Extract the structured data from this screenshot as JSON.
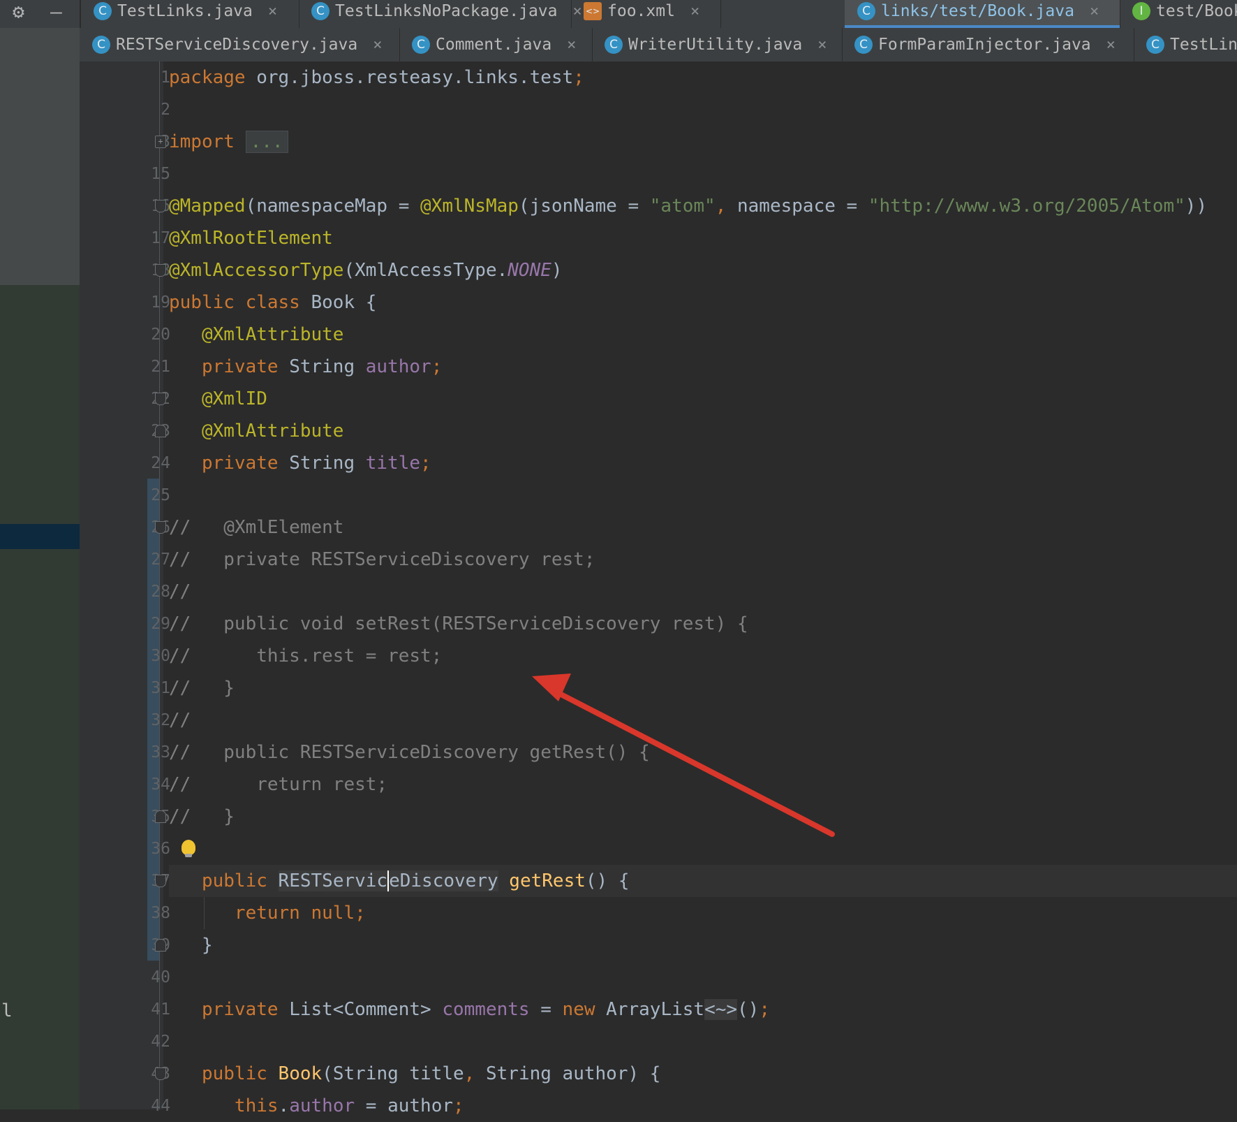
{
  "toolbar": {
    "settings_icon": "gear-icon",
    "hide_icon": "minimize-icon"
  },
  "tabs_row1": [
    {
      "label": "TestLinks.java",
      "icon": "C",
      "active": false
    },
    {
      "label": "TestLinksNoPackage.java",
      "icon": "C",
      "active": false
    },
    {
      "label": "foo.xml",
      "icon": "<>",
      "active": false
    },
    {
      "label": "links/test/Book.java",
      "icon": "C",
      "active": true
    },
    {
      "label": "test/BookStoreSer",
      "icon": "I",
      "active": false
    }
  ],
  "tabs_row2": [
    {
      "label": "RESTServiceDiscovery.java",
      "icon": "C"
    },
    {
      "label": "Comment.java",
      "icon": "C"
    },
    {
      "label": "WriterUtility.java",
      "icon": "C"
    },
    {
      "label": "FormParamInjector.java",
      "icon": "C"
    },
    {
      "label": "TestLin",
      "icon": "C"
    }
  ],
  "close_glyph": "×",
  "left_panel": {
    "stray_char": "l"
  },
  "editor": {
    "line_numbers": [
      "1",
      "2",
      "3",
      "15",
      "16",
      "17",
      "18",
      "19",
      "20",
      "21",
      "22",
      "23",
      "24",
      "25",
      "26",
      "27",
      "28",
      "29",
      "30",
      "31",
      "32",
      "33",
      "34",
      "35",
      "36",
      "37",
      "38",
      "39",
      "40",
      "41",
      "42",
      "43",
      "44"
    ],
    "lines": [
      [
        {
          "t": "package ",
          "c": "kw"
        },
        {
          "t": "org.jboss.resteasy.links.test",
          "c": ""
        },
        {
          "t": ";",
          "c": "kw"
        }
      ],
      [],
      [
        {
          "t": "import ",
          "c": "kw"
        },
        {
          "t": "...",
          "c": "fold-box"
        }
      ],
      [],
      [
        {
          "t": "@Mapped",
          "c": "ann"
        },
        {
          "t": "(namespaceMap = ",
          "c": ""
        },
        {
          "t": "@XmlNsMap",
          "c": "ann"
        },
        {
          "t": "(jsonName = ",
          "c": ""
        },
        {
          "t": "\"atom\"",
          "c": "str"
        },
        {
          "t": ", ",
          "c": "kw"
        },
        {
          "t": "namespace = ",
          "c": ""
        },
        {
          "t": "\"http://www.w3.org/2005/Atom\"",
          "c": "str"
        },
        {
          "t": "))",
          "c": ""
        }
      ],
      [
        {
          "t": "@XmlRootElement",
          "c": "ann"
        }
      ],
      [
        {
          "t": "@XmlAccessorType",
          "c": "ann"
        },
        {
          "t": "(XmlAccessType.",
          "c": ""
        },
        {
          "t": "NONE",
          "c": "fld-i"
        },
        {
          "t": ")",
          "c": ""
        }
      ],
      [
        {
          "t": "public class ",
          "c": "kw"
        },
        {
          "t": "Book {",
          "c": ""
        }
      ],
      [
        {
          "t": "   @XmlAttribute",
          "c": "ann"
        }
      ],
      [
        {
          "t": "   private ",
          "c": "kw"
        },
        {
          "t": "String ",
          "c": ""
        },
        {
          "t": "author",
          "c": "fld"
        },
        {
          "t": ";",
          "c": "kw"
        }
      ],
      [
        {
          "t": "   @XmlID",
          "c": "ann"
        }
      ],
      [
        {
          "t": "   @XmlAttribute",
          "c": "ann"
        }
      ],
      [
        {
          "t": "   private ",
          "c": "kw"
        },
        {
          "t": "String ",
          "c": ""
        },
        {
          "t": "title",
          "c": "fld"
        },
        {
          "t": ";",
          "c": "kw"
        }
      ],
      [],
      [
        {
          "t": "//   @XmlElement",
          "c": "cmt"
        }
      ],
      [
        {
          "t": "//   private RESTServiceDiscovery rest;",
          "c": "cmt"
        }
      ],
      [
        {
          "t": "//",
          "c": "cmt"
        }
      ],
      [
        {
          "t": "//   public void setRest(RESTServiceDiscovery rest) {",
          "c": "cmt"
        }
      ],
      [
        {
          "t": "//      this.rest = rest;",
          "c": "cmt"
        }
      ],
      [
        {
          "t": "//   }",
          "c": "cmt"
        }
      ],
      [
        {
          "t": "//",
          "c": "cmt"
        }
      ],
      [
        {
          "t": "//   public RESTServiceDiscovery getRest() {",
          "c": "cmt"
        }
      ],
      [
        {
          "t": "//      return rest;",
          "c": "cmt"
        }
      ],
      [
        {
          "t": "//   }",
          "c": "cmt"
        }
      ],
      [],
      [
        {
          "t": "   public ",
          "c": "kw"
        },
        {
          "t": "RESTServic",
          "c": "hl"
        },
        {
          "t": "eDiscovery",
          "c": "hl caret"
        },
        {
          "t": " ",
          "c": ""
        },
        {
          "t": "getRest",
          "c": "fn"
        },
        {
          "t": "() {",
          "c": ""
        }
      ],
      [
        {
          "t": "      return null",
          "c": "kw"
        },
        {
          "t": ";",
          "c": "kw"
        }
      ],
      [
        {
          "t": "   }",
          "c": ""
        }
      ],
      [],
      [
        {
          "t": "   private ",
          "c": "kw"
        },
        {
          "t": "List<Comment> ",
          "c": ""
        },
        {
          "t": "comments ",
          "c": "fld"
        },
        {
          "t": "= ",
          "c": ""
        },
        {
          "t": "new ",
          "c": "kw"
        },
        {
          "t": "ArrayList",
          "c": ""
        },
        {
          "t": "<~>",
          "c": "dg"
        },
        {
          "t": "()",
          "c": ""
        },
        {
          "t": ";",
          "c": "kw"
        }
      ],
      [],
      [
        {
          "t": "   public ",
          "c": "kw"
        },
        {
          "t": "Book",
          "c": "fn"
        },
        {
          "t": "(String title",
          "c": ""
        },
        {
          "t": ", ",
          "c": "kw"
        },
        {
          "t": "String author) {",
          "c": ""
        }
      ],
      [
        {
          "t": "      this",
          "c": "kw"
        },
        {
          "t": ".",
          "c": ""
        },
        {
          "t": "author ",
          "c": "fld"
        },
        {
          "t": "= author",
          "c": ""
        },
        {
          "t": ";",
          "c": "kw"
        }
      ]
    ],
    "fold_markers": {
      "2": "plus",
      "4": "cap",
      "6": "cap",
      "10": "cap",
      "11": "end",
      "14": "cap",
      "23": "end",
      "25": "cap",
      "27": "end",
      "31": "cap"
    },
    "intention_bulb_line": 24,
    "caret_line": 25
  },
  "colors": {
    "editor_bg": "#2b2b2b",
    "keyword": "#cc7832",
    "annotation": "#bbb529",
    "string": "#6a8759",
    "field": "#9876aa",
    "comment": "#808080",
    "method": "#ffc66d",
    "arrow": "#d9372b"
  },
  "overlay": {
    "arrow": "annotation-arrow"
  }
}
